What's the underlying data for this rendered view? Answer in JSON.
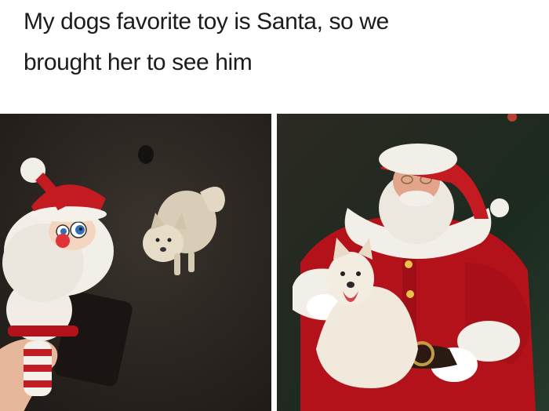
{
  "post": {
    "caption_line1": "My dogs favorite toy is Santa, so we",
    "caption_line2": "brought her to see him"
  },
  "photos": [
    {
      "subject": "Santa plush toy held up in front of a dog on a dark floor"
    },
    {
      "subject": "Dog sitting on the lap of a person dressed as Santa Claus"
    }
  ],
  "colors": {
    "santa_red": "#b3121a",
    "fur_white": "#f2efe8",
    "dog_cream": "#e8dcc8",
    "dark_floor": "#2b2622"
  }
}
